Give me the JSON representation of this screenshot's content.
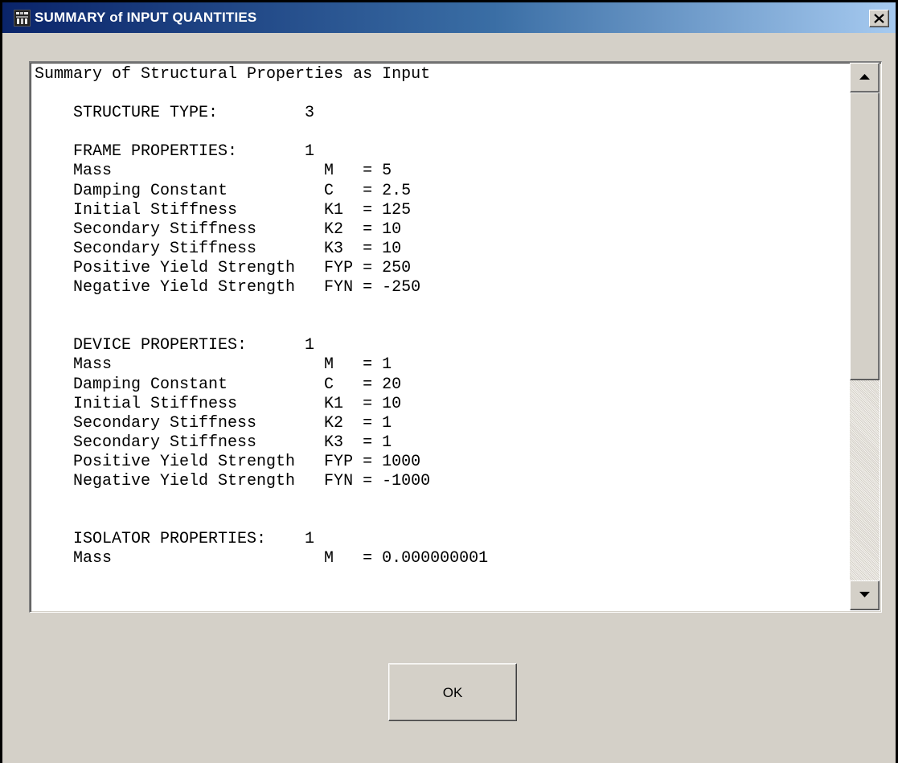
{
  "window": {
    "title": "SUMMARY of INPUT QUANTITIES",
    "app_icon": "app-icon",
    "close_icon": "close-icon",
    "title_gradient": [
      "#0a246a",
      "#a6caf0"
    ]
  },
  "summary": {
    "lines": [
      "Summary of Structural Properties as Input",
      "",
      "    STRUCTURE TYPE:         3",
      "",
      "    FRAME PROPERTIES:       1",
      "    Mass                      M   = 5",
      "    Damping Constant          C   = 2.5",
      "    Initial Stiffness         K1  = 125",
      "    Secondary Stiffness       K2  = 10",
      "    Secondary Stiffness       K3  = 10",
      "    Positive Yield Strength   FYP = 250",
      "    Negative Yield Strength   FYN = -250",
      "",
      "",
      "    DEVICE PROPERTIES:      1",
      "    Mass                      M   = 1",
      "    Damping Constant          C   = 20",
      "    Initial Stiffness         K1  = 10",
      "    Secondary Stiffness       K2  = 1",
      "    Secondary Stiffness       K3  = 1",
      "    Positive Yield Strength   FYP = 1000",
      "    Negative Yield Strength   FYN = -1000",
      "",
      "",
      "    ISOLATOR PROPERTIES:    1",
      "    Mass                      M   = 0.000000001"
    ]
  },
  "scrollbar": {
    "up_icon": "arrow-up-icon",
    "down_icon": "arrow-down-icon",
    "scroll_position": 0
  },
  "buttons": {
    "ok_label": "OK"
  }
}
